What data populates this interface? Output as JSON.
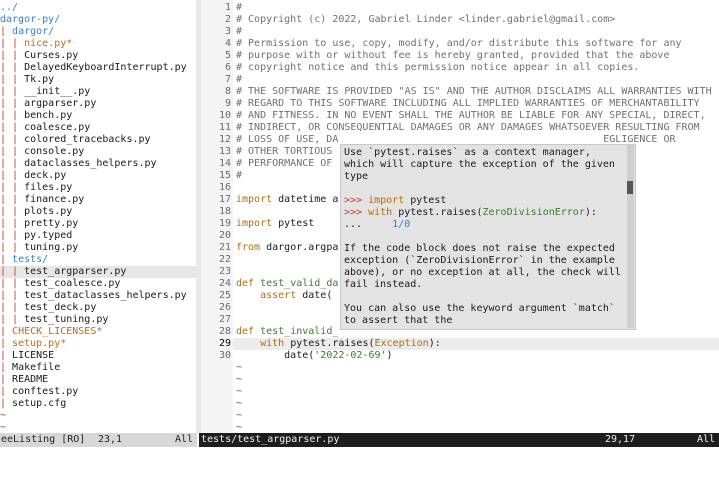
{
  "tree": {
    "rows": [
      {
        "prefix": "",
        "text": "../",
        "cls": "dir"
      },
      {
        "prefix": "",
        "text": "dargor-py/",
        "cls": "dir"
      },
      {
        "prefix": "| ",
        "text": "dargor/",
        "cls": "dir"
      },
      {
        "prefix": "| | ",
        "text": "nice.py*",
        "cls": "orange"
      },
      {
        "prefix": "| | ",
        "text": "Curses.py",
        "cls": ""
      },
      {
        "prefix": "| | ",
        "text": "DelayedKeyboardInterrupt.py",
        "cls": ""
      },
      {
        "prefix": "| | ",
        "text": "Tk.py",
        "cls": ""
      },
      {
        "prefix": "| | ",
        "text": "__init__.py",
        "cls": ""
      },
      {
        "prefix": "| | ",
        "text": "argparser.py",
        "cls": ""
      },
      {
        "prefix": "| | ",
        "text": "bench.py",
        "cls": ""
      },
      {
        "prefix": "| | ",
        "text": "coalesce.py",
        "cls": ""
      },
      {
        "prefix": "| | ",
        "text": "colored_tracebacks.py",
        "cls": ""
      },
      {
        "prefix": "| | ",
        "text": "console.py",
        "cls": ""
      },
      {
        "prefix": "| | ",
        "text": "dataclasses_helpers.py",
        "cls": ""
      },
      {
        "prefix": "| | ",
        "text": "deck.py",
        "cls": ""
      },
      {
        "prefix": "| | ",
        "text": "files.py",
        "cls": ""
      },
      {
        "prefix": "| | ",
        "text": "finance.py",
        "cls": ""
      },
      {
        "prefix": "| | ",
        "text": "plots.py",
        "cls": ""
      },
      {
        "prefix": "| | ",
        "text": "pretty.py",
        "cls": ""
      },
      {
        "prefix": "| | ",
        "text": "py.typed",
        "cls": ""
      },
      {
        "prefix": "| | ",
        "text": "tuning.py",
        "cls": ""
      },
      {
        "prefix": "| ",
        "text": "tests/",
        "cls": "dir"
      },
      {
        "prefix": "| | ",
        "text": "test_argparser.py",
        "cls": "",
        "selected": true
      },
      {
        "prefix": "| | ",
        "text": "test_coalesce.py",
        "cls": ""
      },
      {
        "prefix": "| | ",
        "text": "test_dataclasses_helpers.py",
        "cls": ""
      },
      {
        "prefix": "| | ",
        "text": "test_deck.py",
        "cls": ""
      },
      {
        "prefix": "| | ",
        "text": "test_tuning.py",
        "cls": ""
      },
      {
        "prefix": "| ",
        "text": "CHECK_LICENSES*",
        "cls": "orange"
      },
      {
        "prefix": "| ",
        "text": "setup.py*",
        "cls": "orange"
      },
      {
        "prefix": "| ",
        "text": "LICENSE",
        "cls": ""
      },
      {
        "prefix": "| ",
        "text": "Makefile",
        "cls": ""
      },
      {
        "prefix": "| ",
        "text": "README",
        "cls": ""
      },
      {
        "prefix": "| ",
        "text": "conftest.py",
        "cls": ""
      },
      {
        "prefix": "| ",
        "text": "setup.cfg",
        "cls": ""
      },
      {
        "prefix": "",
        "text": "~",
        "cls": "tilde"
      },
      {
        "prefix": "",
        "text": "~",
        "cls": "tilde"
      }
    ]
  },
  "editor": {
    "lines": [
      {
        "n": "1",
        "html": [
          [
            "cm",
            "#"
          ]
        ]
      },
      {
        "n": "2",
        "html": [
          [
            "cm",
            "# Copyright (c) 2022, Gabriel Linder <linder.gabriel@gmail.com>"
          ]
        ]
      },
      {
        "n": "3",
        "html": [
          [
            "cm",
            "#"
          ]
        ]
      },
      {
        "n": "4",
        "html": [
          [
            "cm",
            "# Permission to use, copy, modify, and/or distribute this software for any"
          ]
        ]
      },
      {
        "n": "5",
        "html": [
          [
            "cm",
            "# purpose with or without fee is hereby granted, provided that the above"
          ]
        ]
      },
      {
        "n": "6",
        "html": [
          [
            "cm",
            "# copyright notice and this permission notice appear in all copies."
          ]
        ]
      },
      {
        "n": "7",
        "html": [
          [
            "cm",
            "#"
          ]
        ]
      },
      {
        "n": "8",
        "html": [
          [
            "cm",
            "# THE SOFTWARE IS PROVIDED \"AS IS\" AND THE AUTHOR DISCLAIMS ALL WARRANTIES WITH"
          ]
        ]
      },
      {
        "n": "9",
        "html": [
          [
            "cm",
            "# REGARD TO THIS SOFTWARE INCLUDING ALL IMPLIED WARRANTIES OF MERCHANTABILITY"
          ]
        ]
      },
      {
        "n": "10",
        "html": [
          [
            "cm",
            "# AND FITNESS. IN NO EVENT SHALL THE AUTHOR BE LIABLE FOR ANY SPECIAL, DIRECT,"
          ]
        ]
      },
      {
        "n": "11",
        "html": [
          [
            "cm",
            "# INDIRECT, OR CONSEQUENTIAL DAMAGES OR ANY DAMAGES WHATSOEVER RESULTING FROM"
          ]
        ]
      },
      {
        "n": "12",
        "html": [
          [
            "cm",
            "# LOSS OF USE, DA"
          ],
          [
            "",
            "                                            "
          ],
          [
            "cm",
            "EGLIGENCE OR"
          ]
        ]
      },
      {
        "n": "13",
        "html": [
          [
            "cm",
            "# OTHER TORTIOUS"
          ],
          [
            "",
            "                                            "
          ],
          [
            "cm",
            "SE OR"
          ]
        ]
      },
      {
        "n": "14",
        "html": [
          [
            "cm",
            "# PERFORMANCE OF"
          ]
        ]
      },
      {
        "n": "15",
        "html": [
          [
            "cm",
            "#"
          ]
        ]
      },
      {
        "n": "16",
        "html": []
      },
      {
        "n": "17",
        "html": [
          [
            "kw",
            "import"
          ],
          [
            "",
            " datetime a"
          ]
        ]
      },
      {
        "n": "18",
        "html": []
      },
      {
        "n": "19",
        "html": [
          [
            "kw",
            "import"
          ],
          [
            "",
            " pytest"
          ]
        ]
      },
      {
        "n": "20",
        "html": []
      },
      {
        "n": "21",
        "html": [
          [
            "kw",
            "from"
          ],
          [
            "",
            " dargor.argpa"
          ]
        ]
      },
      {
        "n": "22",
        "html": []
      },
      {
        "n": "23",
        "html": []
      },
      {
        "n": "24",
        "html": [
          [
            "kw",
            "def"
          ],
          [
            "",
            " "
          ],
          [
            "fn",
            "test_valid_da"
          ]
        ]
      },
      {
        "n": "25",
        "html": [
          [
            "",
            "    "
          ],
          [
            "kw",
            "assert"
          ],
          [
            "",
            " date("
          ]
        ]
      },
      {
        "n": "26",
        "html": []
      },
      {
        "n": "27",
        "html": []
      },
      {
        "n": "28",
        "html": [
          [
            "kw",
            "def"
          ],
          [
            "",
            " "
          ],
          [
            "fn",
            "test_invalid_"
          ]
        ]
      },
      {
        "n": "29",
        "html": [
          [
            "",
            "    "
          ],
          [
            "kw",
            "with"
          ],
          [
            "",
            " pytest.raises("
          ],
          [
            "kw",
            "Exception"
          ],
          [
            "",
            "):"
          ]
        ],
        "cur": true
      },
      {
        "n": "30",
        "html": [
          [
            "",
            "        date("
          ],
          [
            "str",
            "'2022-02-69'"
          ],
          [
            "",
            ")"
          ]
        ]
      },
      {
        "n": "",
        "html": [
          [
            "tilde",
            "~"
          ]
        ]
      },
      {
        "n": "",
        "html": [
          [
            "tilde",
            "~"
          ]
        ]
      },
      {
        "n": "",
        "html": [
          [
            "tilde",
            "~"
          ]
        ]
      },
      {
        "n": "",
        "html": [
          [
            "tilde",
            "~"
          ]
        ]
      },
      {
        "n": "",
        "html": [
          [
            "tilde",
            "~"
          ]
        ]
      },
      {
        "n": "",
        "html": [
          [
            "tilde",
            "~"
          ]
        ]
      }
    ]
  },
  "popup": {
    "lines": [
      [
        [
          "",
          "Use `pytest.raises` as a context manager,"
        ]
      ],
      [
        [
          "",
          "which will capture the exception of the given"
        ]
      ],
      [
        [
          "",
          "type"
        ]
      ],
      [
        [
          "",
          ""
        ]
      ],
      [
        [
          "prompt",
          ">>> "
        ],
        [
          "kw",
          "import"
        ],
        [
          "",
          " pytest"
        ]
      ],
      [
        [
          "prompt",
          ">>> "
        ],
        [
          "kw",
          "with"
        ],
        [
          "",
          " pytest.raises("
        ],
        [
          "fn",
          "ZeroDivisionError"
        ],
        [
          "",
          "):"
        ]
      ],
      [
        [
          "",
          "...     "
        ],
        [
          "pnum",
          "1/0"
        ]
      ],
      [
        [
          "",
          ""
        ]
      ],
      [
        [
          "",
          "If the code block does not raise the expected"
        ]
      ],
      [
        [
          "",
          "exception (`ZeroDivisionError` in the example"
        ]
      ],
      [
        [
          "",
          "above), or no exception at all, the check will"
        ]
      ],
      [
        [
          "",
          "fail instead."
        ]
      ],
      [
        [
          "",
          ""
        ]
      ],
      [
        [
          "",
          "You can also use the keyword argument `match`"
        ]
      ],
      [
        [
          "",
          "to assert that the"
        ]
      ]
    ]
  },
  "status": {
    "left_name": "eeListing [RO]",
    "left_pos": "23,1",
    "left_all": "All",
    "right_name": "tests/test_argparser.py",
    "right_pos": "29,17",
    "right_all": "All"
  }
}
